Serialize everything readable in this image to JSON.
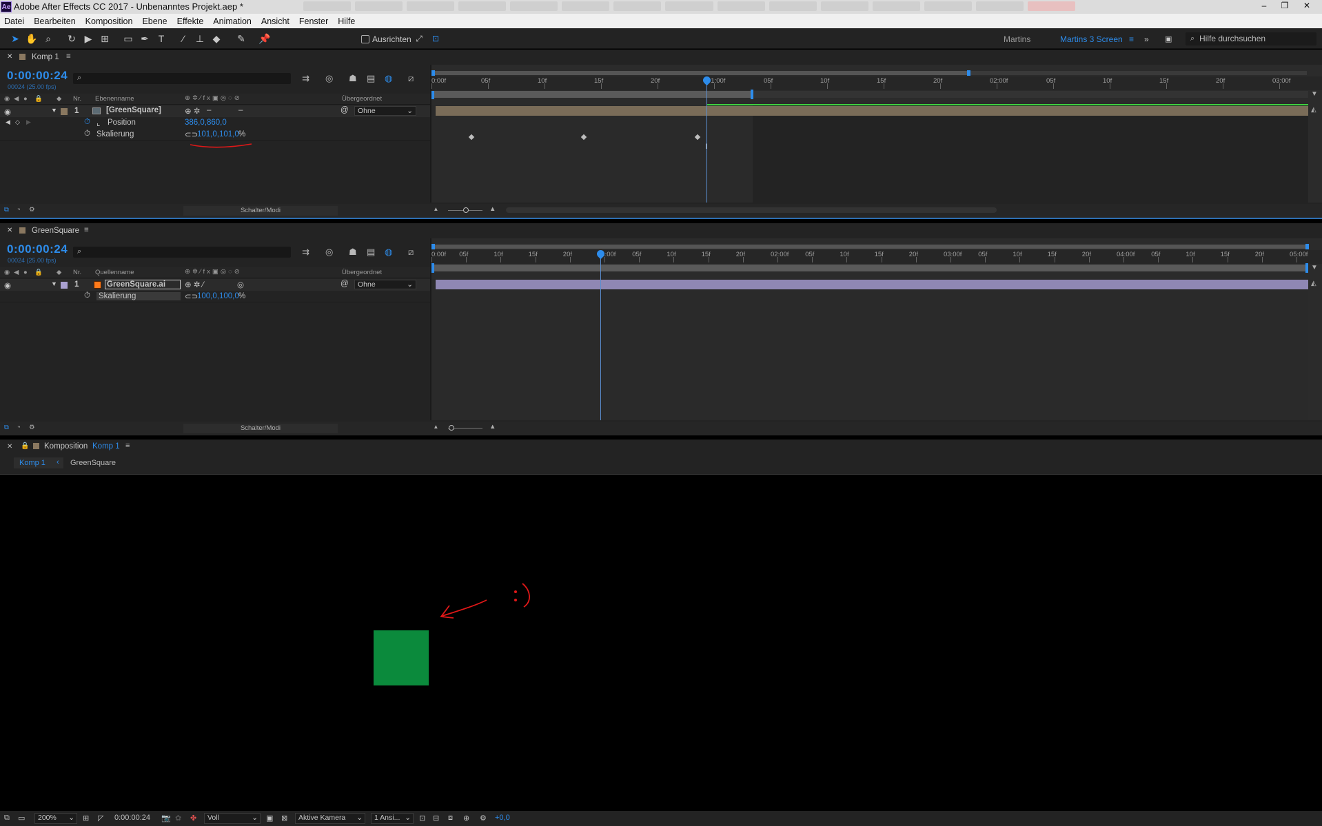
{
  "window": {
    "app_badge": "Ae",
    "title": "Adobe After Effects CC 2017 - Unbenanntes Projekt.aep *",
    "controls": [
      "–",
      "❐",
      "✕"
    ]
  },
  "menu": [
    "Datei",
    "Bearbeiten",
    "Komposition",
    "Ebene",
    "Effekte",
    "Animation",
    "Ansicht",
    "Fenster",
    "Hilfe"
  ],
  "toolbar": {
    "snap_label": "Ausrichten",
    "workspace_user": "Martins",
    "workspace_active": "Martins 3 Screen",
    "search_placeholder": "Hilfe durchsuchen"
  },
  "timeline1": {
    "tab": "Komp 1",
    "timecode": "0:00:00:24",
    "frames": "00024 (25.00 fps)",
    "col_nr": "Nr.",
    "col_name": "Ebenenname",
    "col_parent": "Übergeordnet",
    "layer": {
      "index": "1",
      "name": "[GreenSquare]",
      "parent": "Ohne"
    },
    "properties": [
      {
        "name": "Position",
        "value": "386,0,860,0"
      },
      {
        "name": "Skalierung",
        "value": "101,0,101,0",
        "unit": "%"
      }
    ],
    "ruler_labels": [
      "0:00f",
      "05f",
      "10f",
      "15f",
      "20f",
      "01:00f",
      "05f",
      "10f",
      "15f",
      "20f",
      "02:00f",
      "05f",
      "10f",
      "15f",
      "20f",
      "03:00f"
    ],
    "mode_label": "Schalter/Modi"
  },
  "timeline2": {
    "tab": "GreenSquare",
    "timecode": "0:00:00:24",
    "frames": "00024 (25.00 fps)",
    "col_nr": "Nr.",
    "col_name": "Quellenname",
    "col_parent": "Übergeordnet",
    "layer": {
      "index": "1",
      "name": "GreenSquare.ai",
      "parent": "Ohne"
    },
    "properties": [
      {
        "name": "Skalierung",
        "value": "100,0,100,0",
        "unit": "%"
      }
    ],
    "ruler_labels": [
      "0:00f",
      "05f",
      "10f",
      "15f",
      "20f",
      "01:00f",
      "05f",
      "10f",
      "15f",
      "20f",
      "02:00f",
      "05f",
      "10f",
      "15f",
      "20f",
      "03:00f",
      "05f",
      "10f",
      "15f",
      "20f",
      "04:00f",
      "05f",
      "10f",
      "15f",
      "20f",
      "05:00f"
    ],
    "mode_label": "Schalter/Modi"
  },
  "viewer": {
    "panel_label": "Komposition",
    "panel_comp": "Komp 1",
    "breadcrumbs": [
      "Komp 1",
      "GreenSquare"
    ],
    "square_color": "#0b8a3c"
  },
  "viewer_footer": {
    "zoom": "200%",
    "timecode": "0:00:00:24",
    "resolution": "Voll",
    "camera": "Aktive Kamera",
    "views": "1 Ansi...",
    "exposure": "+0,0"
  }
}
